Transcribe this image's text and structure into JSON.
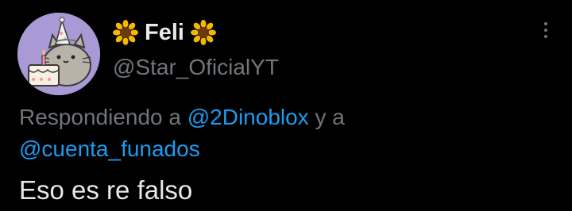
{
  "user": {
    "display_name": "Feli",
    "handle": "@Star_OficialYT",
    "name_emoji": "sunflower-icon"
  },
  "reply": {
    "prefix": "Respondiendo a",
    "mention_1": "@2Dinoblox",
    "connector": "y a",
    "mention_2": "@cuenta_funados"
  },
  "tweet": {
    "text": "Eso es re falso"
  },
  "colors": {
    "background": "#000000",
    "text": "#e7e9ea",
    "muted": "#71767b",
    "link": "#1d9bf0",
    "avatar_bg": "#a99ad6"
  }
}
